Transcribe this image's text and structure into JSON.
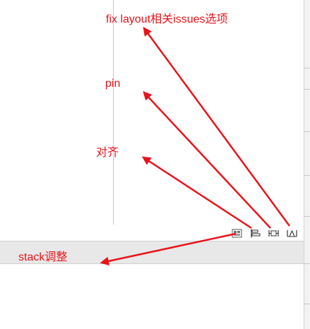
{
  "annotations": {
    "fix_layout": "fix layout相关issues选项",
    "pin": "pin",
    "align": "对齐",
    "stack": "stack调整"
  },
  "toolbar": {
    "buttons": [
      {
        "icon": "stack-icon"
      },
      {
        "icon": "align-icon"
      },
      {
        "icon": "pin-icon"
      },
      {
        "icon": "resolve-issues-icon"
      }
    ]
  },
  "colors": {
    "annotation": "#e8141b",
    "bar": "#e8e8e8"
  }
}
